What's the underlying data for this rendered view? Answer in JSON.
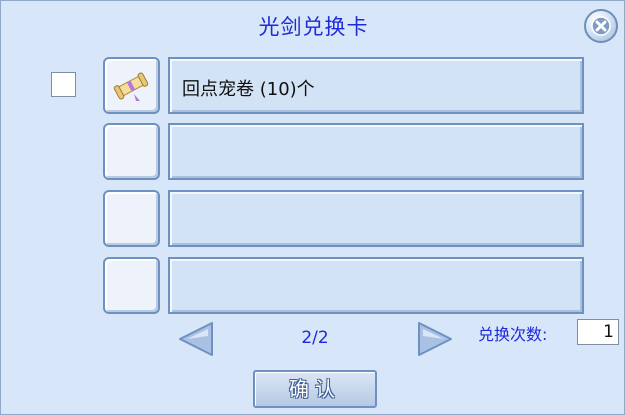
{
  "dialog": {
    "title": "光剑兑换卡"
  },
  "items": [
    {
      "label": "回点宠卷 (10)个",
      "icon": "scroll-icon"
    },
    {
      "label": "",
      "icon": ""
    },
    {
      "label": "",
      "icon": ""
    },
    {
      "label": "",
      "icon": ""
    }
  ],
  "pagination": {
    "indicator": "2/2"
  },
  "exchange": {
    "count_label": "兑换次数:",
    "count_value": "1"
  },
  "confirm_label": "确认",
  "colors": {
    "background": "#d7e6f8",
    "title": "#1f2ad8",
    "border": "#6f91bf"
  }
}
